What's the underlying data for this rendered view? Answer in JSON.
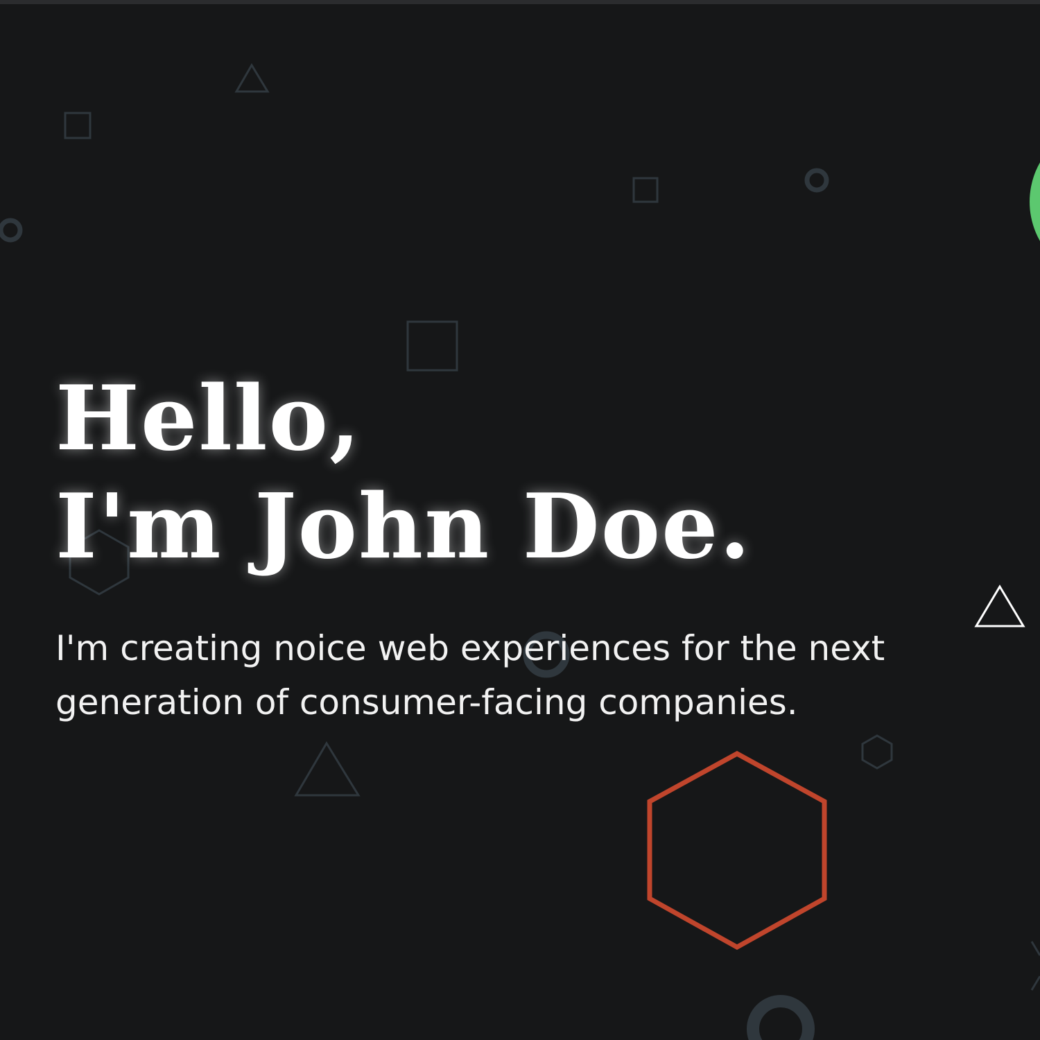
{
  "hero": {
    "greeting": "Hello,",
    "name_line": "I'm John Doe.",
    "tagline": "I'm creating noice web experiences for the next generation of consumer-facing companies."
  },
  "colors": {
    "background": "#161718",
    "shape_muted": "#2f373d",
    "hexagon_accent": "#c0452c",
    "green_circle": "#5cc86f",
    "triangle_highlight": "#ffffff"
  }
}
